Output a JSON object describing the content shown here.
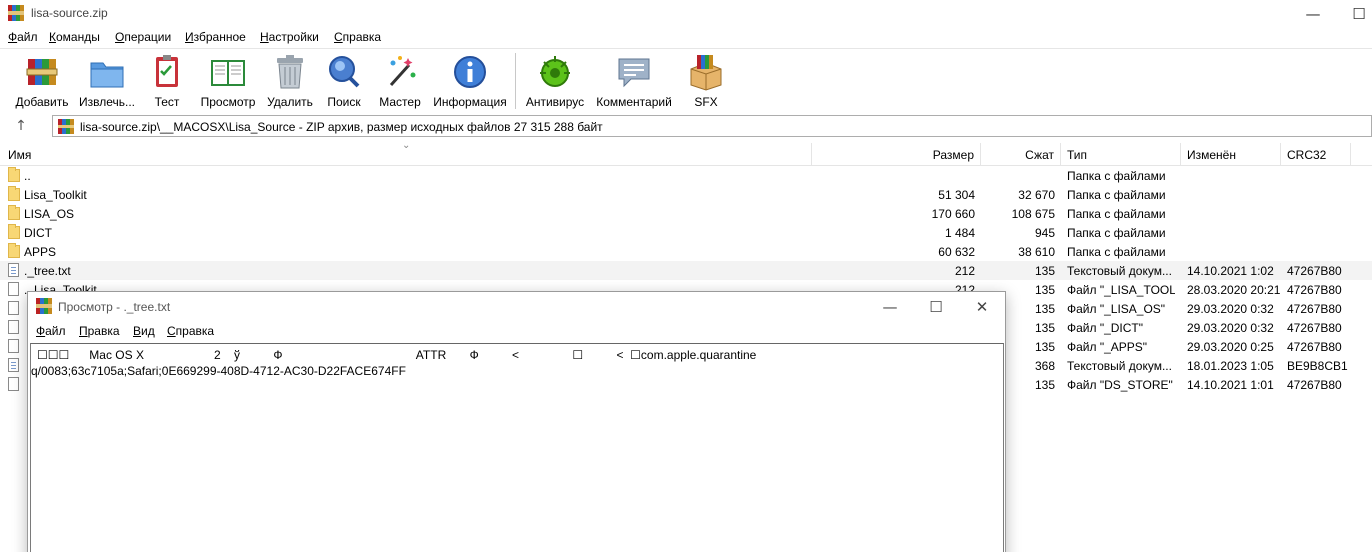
{
  "window": {
    "title": "lisa-source.zip",
    "min": "—",
    "max": "☐",
    "close": "✕"
  },
  "menu": [
    "Файл",
    "Команды",
    "Операции",
    "Избранное",
    "Настройки",
    "Справка"
  ],
  "toolbar": [
    {
      "label": "Добавить",
      "icon": "add-archive-icon"
    },
    {
      "label": "Извлечь...",
      "icon": "extract-icon"
    },
    {
      "label": "Тест",
      "icon": "test-icon"
    },
    {
      "label": "Просмотр",
      "icon": "view-book-icon"
    },
    {
      "label": "Удалить",
      "icon": "trash-icon"
    },
    {
      "label": "Поиск",
      "icon": "magnifier-icon"
    },
    {
      "label": "Мастер",
      "icon": "wizard-wand-icon"
    },
    {
      "label": "Информация",
      "icon": "info-icon"
    },
    {
      "label": "Антивирус",
      "icon": "antivirus-bug-icon"
    },
    {
      "label": "Комментарий",
      "icon": "comment-icon"
    },
    {
      "label": "SFX",
      "icon": "sfx-box-icon"
    }
  ],
  "address": {
    "up": "↑",
    "path": "lisa-source.zip\\__MACOSX\\Lisa_Source - ZIP архив, размер исходных файлов 27 315 288 байт"
  },
  "columns": {
    "name": "Имя",
    "size": "Размер",
    "packed": "Сжат",
    "type": "Тип",
    "modified": "Изменён",
    "crc": "CRC32"
  },
  "rows": [
    {
      "name": "..",
      "size": "",
      "packed": "",
      "type": "Папка с файлами",
      "modified": "",
      "crc": "",
      "kind": "folder"
    },
    {
      "name": "Lisa_Toolkit",
      "size": "51 304",
      "packed": "32 670",
      "type": "Папка с файлами",
      "modified": "",
      "crc": "",
      "kind": "folder"
    },
    {
      "name": "LISA_OS",
      "size": "170 660",
      "packed": "108 675",
      "type": "Папка с файлами",
      "modified": "",
      "crc": "",
      "kind": "folder"
    },
    {
      "name": "DICT",
      "size": "1 484",
      "packed": "945",
      "type": "Папка с файлами",
      "modified": "",
      "crc": "",
      "kind": "folder"
    },
    {
      "name": "APPS",
      "size": "60 632",
      "packed": "38 610",
      "type": "Папка с файлами",
      "modified": "",
      "crc": "",
      "kind": "folder"
    },
    {
      "name": "._tree.txt",
      "size": "212",
      "packed": "135",
      "type": "Текстовый докум...",
      "modified": "14.10.2021 1:02",
      "crc": "47267B80",
      "kind": "txt",
      "selected": true
    },
    {
      "name": "._Lisa_Toolkit",
      "size": "212",
      "packed": "135",
      "type": "Файл \"_LISA_TOOL...",
      "modified": "28.03.2020 20:21",
      "crc": "47267B80",
      "kind": "file"
    },
    {
      "name": "",
      "size": "",
      "packed": "135",
      "type": "Файл \"_LISA_OS\"",
      "modified": "29.03.2020 0:32",
      "crc": "47267B80",
      "kind": "file"
    },
    {
      "name": "",
      "size": "",
      "packed": "135",
      "type": "Файл \"_DICT\"",
      "modified": "29.03.2020 0:32",
      "crc": "47267B80",
      "kind": "file"
    },
    {
      "name": "",
      "size": "",
      "packed": "135",
      "type": "Файл \"_APPS\"",
      "modified": "29.03.2020 0:25",
      "crc": "47267B80",
      "kind": "file"
    },
    {
      "name": "",
      "size": "",
      "packed": "368",
      "type": "Текстовый докум...",
      "modified": "18.01.2023 1:05",
      "crc": "BE9B8CB1",
      "kind": "txt"
    },
    {
      "name": "",
      "size": "",
      "packed": "135",
      "type": "Файл \"DS_STORE\"",
      "modified": "14.10.2021 1:01",
      "crc": "47267B80",
      "kind": "file"
    }
  ],
  "viewer": {
    "title": "Просмотр - ._tree.txt",
    "min": "—",
    "max": "☐",
    "close": "✕",
    "menu": [
      "Файл",
      "Правка",
      "Вид",
      "Справка"
    ],
    "line1": "☐☐☐      Mac OS X                     2    ў          Ф                                        ATTR       Ф          <                ☐          <  ☐com.apple.quarantine",
    "line2": "q/0083;63c7105a;Safari;0E669299-408D-4712-AC30-D22FACE674FF"
  }
}
